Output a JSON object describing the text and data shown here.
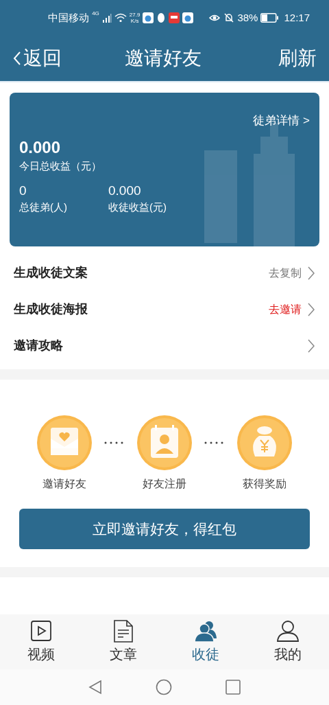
{
  "status_bar": {
    "carrier": "中国移动",
    "network": "4G",
    "speed": "27.9",
    "speed_unit": "K/s",
    "battery": "38%",
    "time": "12:17"
  },
  "header": {
    "back": "返回",
    "title": "邀请好友",
    "action": "刷新"
  },
  "summary": {
    "details_link": "徒弟详情 >",
    "today_value": "0.000",
    "today_label": "今日总收益（元）",
    "stats": [
      {
        "value": "0",
        "label": "总徒弟(人)"
      },
      {
        "value": "0.000",
        "label": "收徒收益(元)"
      }
    ]
  },
  "menu": [
    {
      "label": "生成收徒文案",
      "action": "去复制",
      "highlight": false
    },
    {
      "label": "生成收徒海报",
      "action": "去邀请",
      "highlight": true
    },
    {
      "label": "邀请攻略"
    }
  ],
  "steps": [
    {
      "kind": "envelope",
      "label": "邀请好友"
    },
    {
      "kind": "contact",
      "label": "好友注册"
    },
    {
      "kind": "moneybag",
      "label": "获得奖励"
    }
  ],
  "invite_button": "立即邀请好友，得红包",
  "tabs": [
    {
      "kind": "video",
      "label": "视频",
      "selected": false
    },
    {
      "kind": "article",
      "label": "文章",
      "selected": false
    },
    {
      "kind": "users",
      "label": "收徒",
      "selected": true
    },
    {
      "kind": "user",
      "label": "我的",
      "selected": false
    }
  ]
}
